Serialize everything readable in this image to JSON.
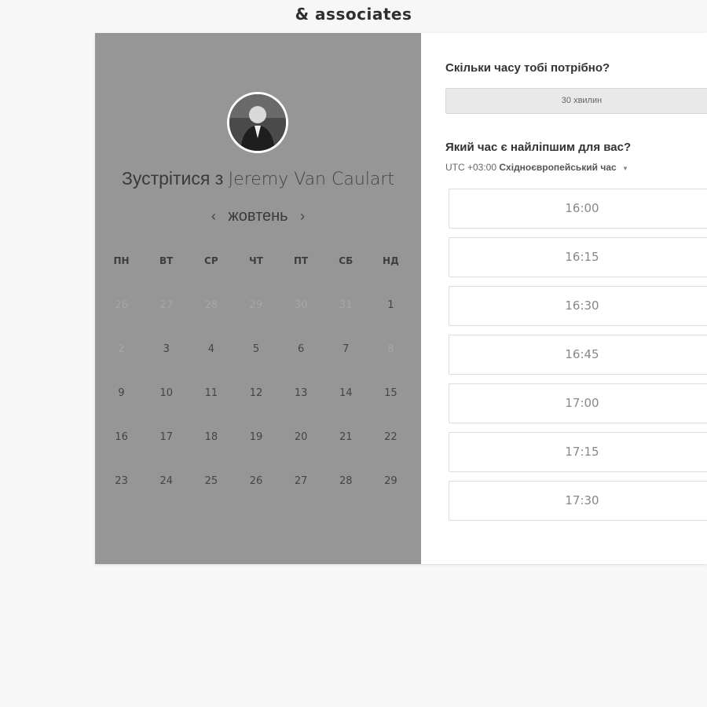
{
  "brand": "& associates",
  "left": {
    "meet_prefix": "Зустрітися з ",
    "person_name": "Jeremy Van Caulart",
    "prev_arrow": "‹",
    "month": "жовтень",
    "next_arrow": "›",
    "weekdays": [
      "ПН",
      "ВТ",
      "СР",
      "ЧТ",
      "ПТ",
      "СБ",
      "НД"
    ],
    "days": [
      {
        "label": "26",
        "muted": true
      },
      {
        "label": "27",
        "muted": true
      },
      {
        "label": "28",
        "muted": true
      },
      {
        "label": "29",
        "muted": true
      },
      {
        "label": "30",
        "muted": true
      },
      {
        "label": "31",
        "muted": true
      },
      {
        "label": "1",
        "muted": false
      },
      {
        "label": "2",
        "muted": true
      },
      {
        "label": "3",
        "muted": false
      },
      {
        "label": "4",
        "muted": false
      },
      {
        "label": "5",
        "muted": false
      },
      {
        "label": "6",
        "muted": false
      },
      {
        "label": "7",
        "muted": false
      },
      {
        "label": "8",
        "muted": true
      },
      {
        "label": "9",
        "muted": false
      },
      {
        "label": "10",
        "muted": false
      },
      {
        "label": "11",
        "muted": false
      },
      {
        "label": "12",
        "muted": false
      },
      {
        "label": "13",
        "muted": false
      },
      {
        "label": "14",
        "muted": false
      },
      {
        "label": "15",
        "muted": false
      },
      {
        "label": "16",
        "muted": false
      },
      {
        "label": "17",
        "muted": false
      },
      {
        "label": "18",
        "muted": false
      },
      {
        "label": "19",
        "muted": false
      },
      {
        "label": "20",
        "muted": false
      },
      {
        "label": "21",
        "muted": false
      },
      {
        "label": "22",
        "muted": false
      },
      {
        "label": "23",
        "muted": false
      },
      {
        "label": "24",
        "muted": false
      },
      {
        "label": "25",
        "muted": false
      },
      {
        "label": "26",
        "muted": false
      },
      {
        "label": "27",
        "muted": false
      },
      {
        "label": "28",
        "muted": false
      },
      {
        "label": "29",
        "muted": false
      }
    ]
  },
  "right": {
    "duration_question": "Скільки часу тобі потрібно?",
    "duration_value": "30 хвилин",
    "time_question": "Який час є найліпшим для вас?",
    "tz_offset": "UTC +03:00",
    "tz_name": "Східноєвропейський час",
    "tz_caret": "▼",
    "slots": [
      "16:00",
      "16:15",
      "16:30",
      "16:45",
      "17:00",
      "17:15",
      "17:30",
      ""
    ]
  },
  "colors": {
    "page_bg": "#f7f7f7",
    "left_panel_bg": "#969696",
    "muted_day": "#a6a6a6",
    "duration_bg": "#e9e9e9"
  }
}
